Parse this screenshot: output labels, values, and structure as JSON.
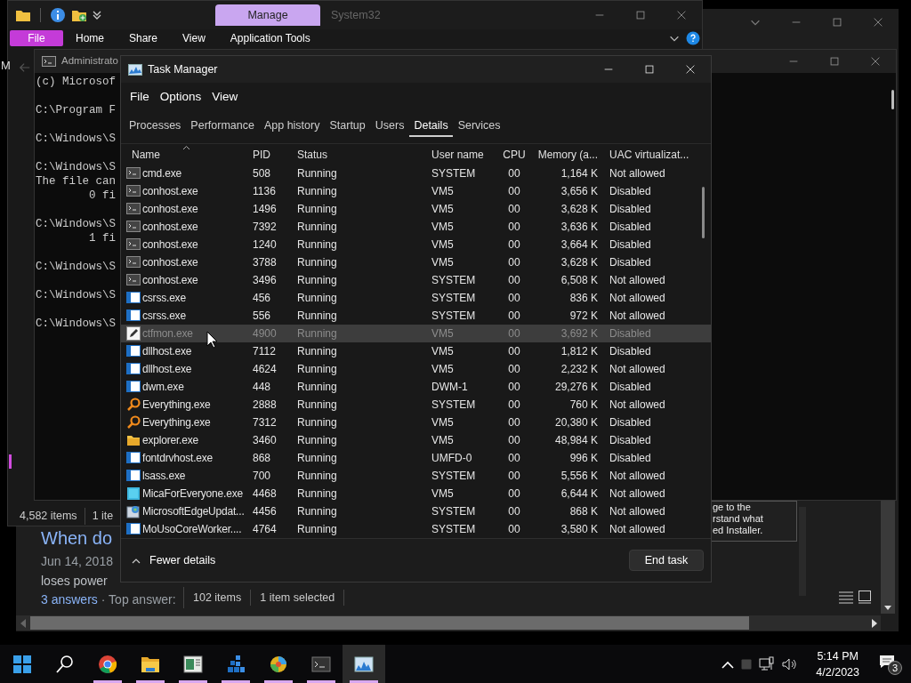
{
  "explorer": {
    "manage_tab": "Manage",
    "title": "System32",
    "ribbon_tabs": [
      {
        "label": "File",
        "selected": true
      },
      {
        "label": "Home",
        "selected": false
      },
      {
        "label": "Share",
        "selected": false
      },
      {
        "label": "View",
        "selected": false
      },
      {
        "label": "Application Tools",
        "selected": false
      }
    ],
    "nav_text": "M",
    "status": [
      "4,582 items",
      "1 ite"
    ]
  },
  "back_window": {
    "status": [
      "102 items",
      "1 item selected"
    ],
    "web": {
      "heading": "When do",
      "date": "Jun 14, 2018",
      "snippet": "loses power",
      "answers": "3 answers",
      "top_answer": "· Top answer:",
      "card_lines": [
        "ge to the",
        "rstand what",
        "ed Installer."
      ]
    }
  },
  "console": {
    "title": "Administrato",
    "blocks": [
      [
        "(c) Microsof"
      ],
      [
        "C:\\Program F"
      ],
      [
        "C:\\Windows\\S"
      ],
      [
        "C:\\Windows\\S",
        "The file can",
        "        0 fi"
      ],
      [
        "C:\\Windows\\S",
        "        1 fi"
      ],
      [
        "C:\\Windows\\S"
      ],
      [
        "C:\\Windows\\S"
      ],
      [
        "C:\\Windows\\S"
      ]
    ]
  },
  "task_manager": {
    "title": "Task Manager",
    "menu": [
      "File",
      "Options",
      "View"
    ],
    "tabs": [
      {
        "label": "Processes",
        "selected": false
      },
      {
        "label": "Performance",
        "selected": false
      },
      {
        "label": "App history",
        "selected": false
      },
      {
        "label": "Startup",
        "selected": false
      },
      {
        "label": "Users",
        "selected": false
      },
      {
        "label": "Details",
        "selected": true
      },
      {
        "label": "Services",
        "selected": false
      }
    ],
    "columns": [
      "Name",
      "PID",
      "Status",
      "User name",
      "CPU",
      "Memory (a...",
      "UAC virtualizat..."
    ],
    "rows": [
      {
        "kind": "console",
        "name": "cmd.exe",
        "pid": "508",
        "status": "Running",
        "user": "SYSTEM",
        "cpu": "00",
        "memory": "1,164 K",
        "uac": "Not allowed",
        "selected": false
      },
      {
        "kind": "console",
        "name": "conhost.exe",
        "pid": "1136",
        "status": "Running",
        "user": "VM5",
        "cpu": "00",
        "memory": "3,656 K",
        "uac": "Disabled",
        "selected": false
      },
      {
        "kind": "console",
        "name": "conhost.exe",
        "pid": "1496",
        "status": "Running",
        "user": "VM5",
        "cpu": "00",
        "memory": "3,628 K",
        "uac": "Disabled",
        "selected": false
      },
      {
        "kind": "console",
        "name": "conhost.exe",
        "pid": "7392",
        "status": "Running",
        "user": "VM5",
        "cpu": "00",
        "memory": "3,636 K",
        "uac": "Disabled",
        "selected": false
      },
      {
        "kind": "console",
        "name": "conhost.exe",
        "pid": "1240",
        "status": "Running",
        "user": "VM5",
        "cpu": "00",
        "memory": "3,664 K",
        "uac": "Disabled",
        "selected": false
      },
      {
        "kind": "console",
        "name": "conhost.exe",
        "pid": "3788",
        "status": "Running",
        "user": "VM5",
        "cpu": "00",
        "memory": "3,628 K",
        "uac": "Disabled",
        "selected": false
      },
      {
        "kind": "console",
        "name": "conhost.exe",
        "pid": "3496",
        "status": "Running",
        "user": "SYSTEM",
        "cpu": "00",
        "memory": "6,508 K",
        "uac": "Not allowed",
        "selected": false
      },
      {
        "kind": "window",
        "name": "csrss.exe",
        "pid": "456",
        "status": "Running",
        "user": "SYSTEM",
        "cpu": "00",
        "memory": "836 K",
        "uac": "Not allowed",
        "selected": false
      },
      {
        "kind": "window",
        "name": "csrss.exe",
        "pid": "556",
        "status": "Running",
        "user": "SYSTEM",
        "cpu": "00",
        "memory": "972 K",
        "uac": "Not allowed",
        "selected": false
      },
      {
        "kind": "pen",
        "name": "ctfmon.exe",
        "pid": "4900",
        "status": "Running",
        "user": "VM5",
        "cpu": "00",
        "memory": "3,692 K",
        "uac": "Disabled",
        "selected": true
      },
      {
        "kind": "window",
        "name": "dllhost.exe",
        "pid": "7112",
        "status": "Running",
        "user": "VM5",
        "cpu": "00",
        "memory": "1,812 K",
        "uac": "Disabled",
        "selected": false
      },
      {
        "kind": "window",
        "name": "dllhost.exe",
        "pid": "4624",
        "status": "Running",
        "user": "VM5",
        "cpu": "00",
        "memory": "2,232 K",
        "uac": "Not allowed",
        "selected": false
      },
      {
        "kind": "window",
        "name": "dwm.exe",
        "pid": "448",
        "status": "Running",
        "user": "DWM-1",
        "cpu": "00",
        "memory": "29,276 K",
        "uac": "Disabled",
        "selected": false
      },
      {
        "kind": "magnifier",
        "name": "Everything.exe",
        "pid": "2888",
        "status": "Running",
        "user": "SYSTEM",
        "cpu": "00",
        "memory": "760 K",
        "uac": "Not allowed",
        "selected": false
      },
      {
        "kind": "magnifier",
        "name": "Everything.exe",
        "pid": "7312",
        "status": "Running",
        "user": "VM5",
        "cpu": "00",
        "memory": "20,380 K",
        "uac": "Disabled",
        "selected": false
      },
      {
        "kind": "folder",
        "name": "explorer.exe",
        "pid": "3460",
        "status": "Running",
        "user": "VM5",
        "cpu": "00",
        "memory": "48,984 K",
        "uac": "Disabled",
        "selected": false
      },
      {
        "kind": "window",
        "name": "fontdrvhost.exe",
        "pid": "868",
        "status": "Running",
        "user": "UMFD-0",
        "cpu": "00",
        "memory": "996 K",
        "uac": "Disabled",
        "selected": false
      },
      {
        "kind": "window",
        "name": "lsass.exe",
        "pid": "700",
        "status": "Running",
        "user": "SYSTEM",
        "cpu": "00",
        "memory": "5,556 K",
        "uac": "Not allowed",
        "selected": false
      },
      {
        "kind": "square",
        "name": "MicaForEveryone.exe",
        "pid": "4468",
        "status": "Running",
        "user": "VM5",
        "cpu": "00",
        "memory": "6,644 K",
        "uac": "Not allowed",
        "selected": false
      },
      {
        "kind": "installer",
        "name": "MicrosoftEdgeUpdat...",
        "pid": "4456",
        "status": "Running",
        "user": "SYSTEM",
        "cpu": "00",
        "memory": "868 K",
        "uac": "Not allowed",
        "selected": false
      },
      {
        "kind": "window",
        "name": "MoUsoCoreWorker....",
        "pid": "4764",
        "status": "Running",
        "user": "SYSTEM",
        "cpu": "00",
        "memory": "3,580 K",
        "uac": "Not allowed",
        "selected": false
      }
    ],
    "fewer_details": "Fewer details",
    "end_task": "End task"
  },
  "taskbar": {
    "apps": [
      {
        "kind": "start",
        "running": false,
        "selected": false
      },
      {
        "kind": "search",
        "running": false,
        "selected": false
      },
      {
        "kind": "chrome",
        "running": true,
        "selected": false
      },
      {
        "kind": "folder",
        "running": true,
        "selected": false
      },
      {
        "kind": "document",
        "running": true,
        "selected": false
      },
      {
        "kind": "blocks",
        "running": true,
        "selected": false
      },
      {
        "kind": "orb",
        "running": true,
        "selected": false
      },
      {
        "kind": "console",
        "running": true,
        "selected": false
      },
      {
        "kind": "chart",
        "running": true,
        "selected": true
      }
    ],
    "time": "5:14 PM",
    "date": "4/2/2023",
    "notifications": "3"
  }
}
